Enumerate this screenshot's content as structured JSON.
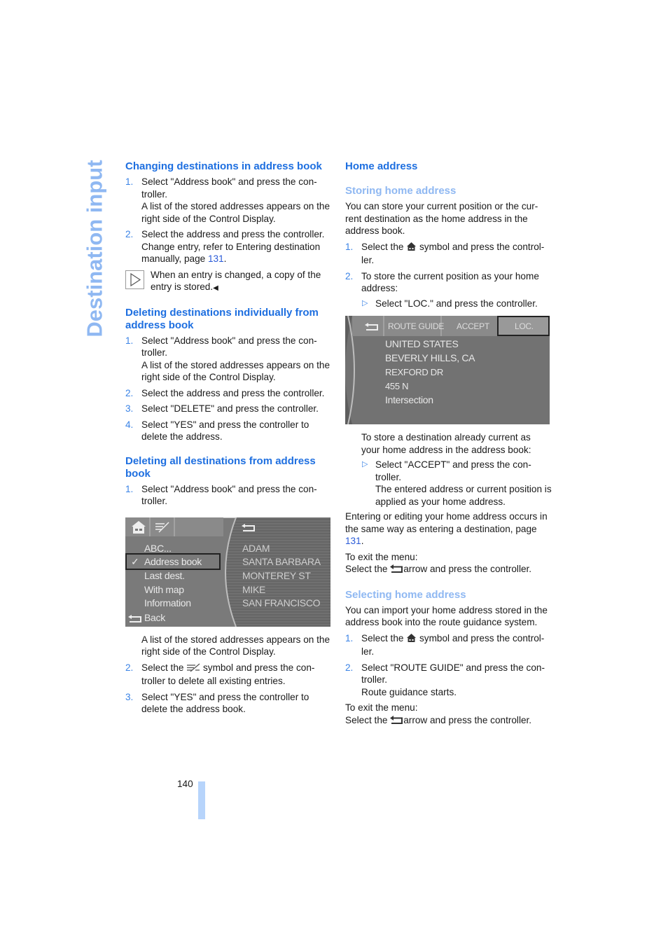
{
  "side_title": "Destination input",
  "page_number": "140",
  "left": {
    "changing": {
      "heading": "Changing destinations in address book",
      "steps": [
        {
          "num": "1.",
          "text": "Select \"Address book\" and press the con-troller.",
          "line1": "Select \"Address book\" and press the con-",
          "line2": "troller.",
          "extra": "A list of the stored addresses appears on the right side of the Control Display."
        },
        {
          "num": "2.",
          "text_before": "Select the address and press the controller. Change entry, refer to Entering destination manually, page ",
          "link": "131",
          "text_after": "."
        }
      ],
      "note": "When an entry is changed, a copy of the entry is stored."
    },
    "deleting_individual": {
      "heading": "Deleting destinations individually from address book",
      "steps": [
        {
          "num": "1.",
          "text": "Select \"Address book\" and press the con-troller.",
          "extra": "A list of the stored addresses appears on the right side of the Control Display."
        },
        {
          "num": "2.",
          "text": "Select the address and press the controller."
        },
        {
          "num": "3.",
          "text": "Select \"DELETE\" and press the controller."
        },
        {
          "num": "4.",
          "text": "Select \"YES\" and press the controller to delete the address."
        }
      ]
    },
    "deleting_all": {
      "heading": "Deleting all destinations from address book",
      "steps": [
        {
          "num": "1.",
          "text": "Select \"Address book\" and press the con-troller."
        }
      ],
      "screen": {
        "menu_items": [
          "ABC...",
          "Address book",
          "Last dest.",
          "With map",
          "Information",
          "Back"
        ],
        "selected": "Address book",
        "addresses": [
          "ADAM",
          "SANTA BARBARA",
          "MONTEREY ST",
          "MIKE",
          "SAN FRANCISCO"
        ],
        "icons": [
          "home-icon",
          "delete-all-icon",
          "back-arrow-icon"
        ]
      },
      "after_text": "A list of the stored addresses appears on the right side of the Control Display.",
      "steps2": [
        {
          "num": "2.",
          "before": "Select the ",
          "after": " symbol and press the con-troller to delete all existing entries."
        },
        {
          "num": "3.",
          "text": "Select \"YES\" and press the controller to delete the address book."
        }
      ]
    }
  },
  "right": {
    "home": {
      "heading": "Home address",
      "storing": {
        "heading": "Storing home address",
        "intro": "You can store your current position or the cur-rent destination as the home address in the address book.",
        "steps": [
          {
            "num": "1.",
            "before": "Select the ",
            "after": " symbol and press the control-ler."
          },
          {
            "num": "2.",
            "text": "To store the current position as your home address:"
          }
        ],
        "sub": "Select \"LOC.\" and press the controller.",
        "screen": {
          "buttons": [
            "ROUTE GUIDE",
            "ACCEPT",
            "LOC."
          ],
          "active": "LOC.",
          "lines": [
            "UNITED STATES",
            "BEVERLY HILLS, CA",
            "REXFORD DR",
            "455 N",
            "Intersection"
          ]
        },
        "after_screen": "To store a destination already current as your home address in the address book:",
        "sub2": "Select \"ACCEPT\" and press the con-troller.",
        "sub2_extra": "The entered address or current position is applied as your home address.",
        "editing_before": "Entering or editing your home address occurs in the same way as entering a destination, page ",
        "editing_link": "131",
        "editing_after": ".",
        "exit_label": "To exit the menu:",
        "exit_before": "Select the ",
        "exit_after": "arrow and press the controller."
      },
      "selecting": {
        "heading": "Selecting home address",
        "intro": "You can import your home address stored in the address book into the route guidance system.",
        "steps": [
          {
            "num": "1.",
            "before": "Select the ",
            "after": " symbol and press the control-ler."
          },
          {
            "num": "2.",
            "text": "Select \"ROUTE GUIDE\" and press the con-troller.",
            "extra": "Route guidance starts."
          }
        ],
        "exit_label": "To exit the menu:",
        "exit_before": "Select the ",
        "exit_after": "arrow and press the controller."
      }
    }
  },
  "colors": {
    "heading": "#1e6fe0",
    "subheading": "#8fb8f2",
    "side_title": "#8fb8f2",
    "link": "#2a5ad8",
    "page_bar": "#b7d4fb"
  }
}
